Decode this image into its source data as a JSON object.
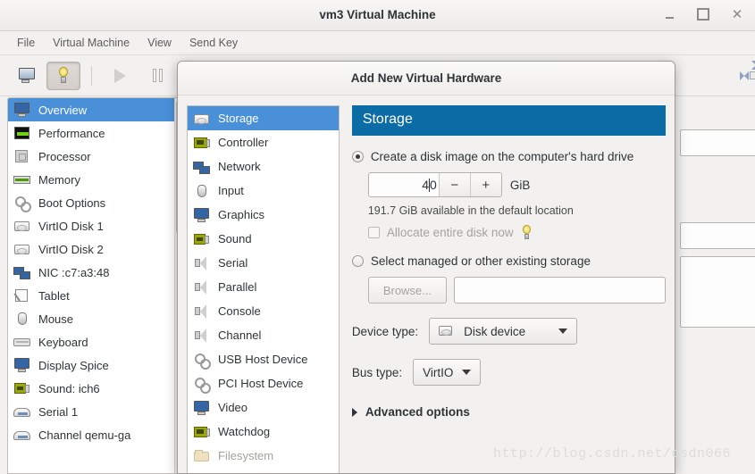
{
  "window": {
    "title": "vm3 Virtual Machine",
    "controls": {
      "minimize": "–",
      "maximize": "□",
      "close": "✕"
    },
    "menus": [
      "File",
      "Virtual Machine",
      "View",
      "Send Key"
    ],
    "toolbar": [
      {
        "name": "console-view-button",
        "icon": "monitor-icon",
        "active": false
      },
      {
        "name": "details-view-button",
        "icon": "lightbulb-icon",
        "active": true
      },
      {
        "name": "run-button",
        "icon": "play-icon",
        "active": false
      },
      {
        "name": "pause-button",
        "icon": "pause-icon",
        "active": false
      },
      {
        "name": "fullscreen-button",
        "icon": "expand-icon",
        "active": false
      }
    ]
  },
  "vm_sidebar": {
    "items": [
      {
        "label": "Overview",
        "icon": "monitor-icon",
        "selected": true
      },
      {
        "label": "Performance",
        "icon": "performance-graph-icon",
        "selected": false
      },
      {
        "label": "Processor",
        "icon": "cpu-icon",
        "selected": false
      },
      {
        "label": "Memory",
        "icon": "memory-icon",
        "selected": false
      },
      {
        "label": "Boot Options",
        "icon": "gears-icon",
        "selected": false
      },
      {
        "label": "VirtIO Disk 1",
        "icon": "disk-icon",
        "selected": false
      },
      {
        "label": "VirtIO Disk 2",
        "icon": "disk-icon",
        "selected": false
      },
      {
        "label": "NIC :c7:a3:48",
        "icon": "network-card-icon",
        "selected": false
      },
      {
        "label": "Tablet",
        "icon": "tablet-icon",
        "selected": false
      },
      {
        "label": "Mouse",
        "icon": "mouse-icon",
        "selected": false
      },
      {
        "label": "Keyboard",
        "icon": "keyboard-icon",
        "selected": false
      },
      {
        "label": "Display Spice",
        "icon": "monitor-icon",
        "selected": false
      },
      {
        "label": "Sound: ich6",
        "icon": "sound-card-icon",
        "selected": false
      },
      {
        "label": "Serial 1",
        "icon": "serial-port-icon",
        "selected": false
      },
      {
        "label": "Channel qemu-ga",
        "icon": "serial-port-icon",
        "selected": false
      }
    ]
  },
  "dialog": {
    "title": "Add New Virtual Hardware",
    "device_list": [
      {
        "label": "Storage",
        "icon": "storage-icon",
        "selected": true,
        "disabled": false
      },
      {
        "label": "Controller",
        "icon": "controller-card-icon",
        "selected": false,
        "disabled": false
      },
      {
        "label": "Network",
        "icon": "network-card-icon",
        "selected": false,
        "disabled": false
      },
      {
        "label": "Input",
        "icon": "mouse-icon",
        "selected": false,
        "disabled": false
      },
      {
        "label": "Graphics",
        "icon": "monitor-icon",
        "selected": false,
        "disabled": false
      },
      {
        "label": "Sound",
        "icon": "sound-card-icon",
        "selected": false,
        "disabled": false
      },
      {
        "label": "Serial",
        "icon": "speaker-icon",
        "selected": false,
        "disabled": false
      },
      {
        "label": "Parallel",
        "icon": "speaker-icon",
        "selected": false,
        "disabled": false
      },
      {
        "label": "Console",
        "icon": "speaker-icon",
        "selected": false,
        "disabled": false
      },
      {
        "label": "Channel",
        "icon": "speaker-icon",
        "selected": false,
        "disabled": false
      },
      {
        "label": "USB Host Device",
        "icon": "gears-icon",
        "selected": false,
        "disabled": false
      },
      {
        "label": "PCI Host Device",
        "icon": "gears-icon",
        "selected": false,
        "disabled": false
      },
      {
        "label": "Video",
        "icon": "monitor-icon",
        "selected": false,
        "disabled": false
      },
      {
        "label": "Watchdog",
        "icon": "controller-card-icon",
        "selected": false,
        "disabled": false
      },
      {
        "label": "Filesystem",
        "icon": "folder-icon",
        "selected": false,
        "disabled": true
      }
    ],
    "pane": {
      "heading": "Storage",
      "create_option": {
        "label": "Create a disk image on the computer's hard drive",
        "selected": true,
        "size_value_before_caret": "4",
        "size_value_after_caret": "0",
        "size_value": "40",
        "decrement_label": "−",
        "increment_label": "+",
        "unit": "GiB",
        "available_text": "191.7 GiB available in the default location",
        "allocate_label": "Allocate entire disk now",
        "allocate_checked": false,
        "allocate_disabled": true
      },
      "managed_option": {
        "label": "Select managed or other existing storage",
        "selected": false,
        "browse_label": "Browse...",
        "browse_disabled": true,
        "path_value": ""
      },
      "device_type": {
        "label": "Device type:",
        "value": "Disk device",
        "icon": "storage-icon"
      },
      "bus_type": {
        "label": "Bus type:",
        "value": "VirtIO"
      },
      "advanced": {
        "label": "Advanced options",
        "expanded": false
      }
    }
  },
  "watermark": "http://blog.csdn.net/csdn066",
  "colors": {
    "selection_blue": "#4a90d9",
    "header_blue": "#0c6ca5",
    "window_bg": "#f2f1f0",
    "text": "#2e3436",
    "disabled_text": "#a7a29d"
  }
}
